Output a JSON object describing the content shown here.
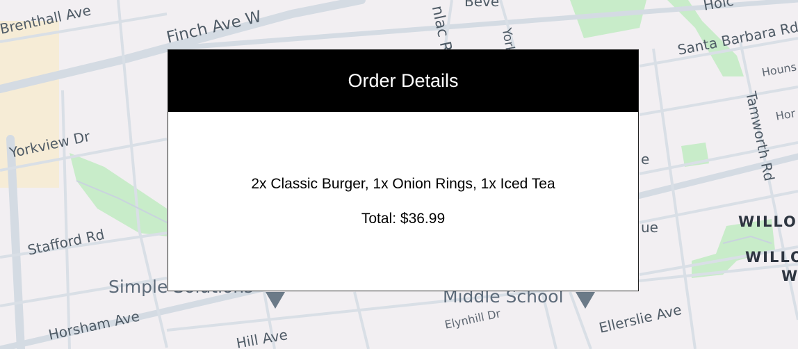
{
  "map": {
    "streets": [
      {
        "id": "finch",
        "text": "Finch Ave W"
      },
      {
        "id": "brenthall",
        "text": "Brenthall Ave"
      },
      {
        "id": "yorkview",
        "text": "Yorkview Dr"
      },
      {
        "id": "stafford",
        "text": "Stafford Rd"
      },
      {
        "id": "horsham",
        "text": "Horsham Ave"
      },
      {
        "id": "hill",
        "text": "Hill Ave"
      },
      {
        "id": "elynhill",
        "text": "Elynhill Dr"
      },
      {
        "id": "ellerslie",
        "text": "Ellerslie Ave"
      },
      {
        "id": "tamworth",
        "text": "Tamworth Rd"
      },
      {
        "id": "santa-barbara",
        "text": "Santa Barbara Rd"
      },
      {
        "id": "bev",
        "text": "Beve"
      },
      {
        "id": "york",
        "text": "York"
      },
      {
        "id": "dunlac",
        "text": "nlac Ro"
      },
      {
        "id": "hounslow",
        "text": "Houns"
      },
      {
        "id": "hor",
        "text": "Hor"
      },
      {
        "id": "holc",
        "text": "Holc"
      },
      {
        "id": "ave-e",
        "text": "e"
      },
      {
        "id": "ave-ue",
        "text": "ue"
      }
    ],
    "pois": [
      {
        "id": "simple-solutions",
        "text": "Simple Solutions"
      },
      {
        "id": "middle-school",
        "text": "Middle School"
      }
    ],
    "areas": [
      {
        "id": "willo-1",
        "text": "WILLO"
      },
      {
        "id": "willo-2",
        "text": "WILLO"
      },
      {
        "id": "willo-3",
        "text": "W"
      }
    ],
    "colors": {
      "background": "#f2eff2",
      "road": "#d4dbe3",
      "park": "#c8ecc9",
      "commercial": "#f6ecd6"
    }
  },
  "modal": {
    "title": "Order Details",
    "items": "2x Classic Burger, 1x Onion Rings, 1x Iced Tea",
    "total": "Total: $36.99"
  }
}
